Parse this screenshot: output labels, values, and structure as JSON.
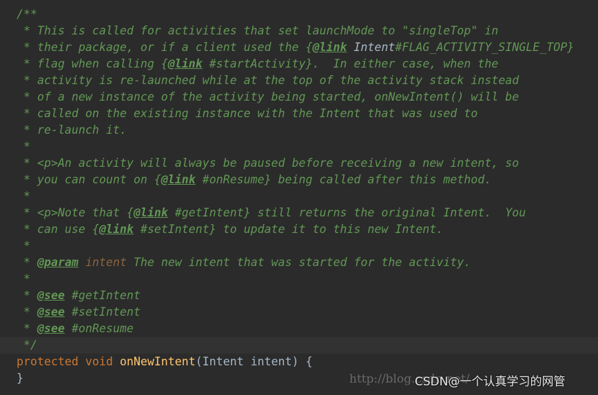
{
  "colors": {
    "background": "#2b2b2b",
    "comment": "#629755",
    "keyword": "#cc7832",
    "function": "#ffc66d",
    "identifier": "#a9b7c6",
    "param": "#8a653b",
    "current_line": "#323232"
  },
  "current_line_index": 20,
  "lines": [
    [
      [
        "c",
        "/**"
      ]
    ],
    [
      [
        "c",
        " * This is called for activities that set launchMode to \"singleTop\" in"
      ]
    ],
    [
      [
        "c",
        " * their package, or if a client used the {"
      ],
      [
        "t",
        "@link"
      ],
      [
        "c",
        " "
      ],
      [
        "r",
        "Intent"
      ],
      [
        "c",
        "#FLAG_ACTIVITY_SINGLE_TOP}"
      ]
    ],
    [
      [
        "c",
        " * flag when calling {"
      ],
      [
        "t",
        "@link"
      ],
      [
        "c",
        " #startActivity}.  In either case, when the"
      ]
    ],
    [
      [
        "c",
        " * activity is re-launched while at the top of the activity stack instead"
      ]
    ],
    [
      [
        "c",
        " * of a new instance of the activity being started, onNewIntent() will be"
      ]
    ],
    [
      [
        "c",
        " * called on the existing instance with the Intent that was used to"
      ]
    ],
    [
      [
        "c",
        " * re-launch it."
      ]
    ],
    [
      [
        "c",
        " *"
      ]
    ],
    [
      [
        "c",
        " * <p>An activity will always be paused before receiving a new intent, so"
      ]
    ],
    [
      [
        "c",
        " * you can count on {"
      ],
      [
        "t",
        "@link"
      ],
      [
        "c",
        " #onResume} being called after this method."
      ]
    ],
    [
      [
        "c",
        " *"
      ]
    ],
    [
      [
        "c",
        " * <p>Note that {"
      ],
      [
        "t",
        "@link"
      ],
      [
        "c",
        " #getIntent} still returns the original Intent.  You"
      ]
    ],
    [
      [
        "c",
        " * can use {"
      ],
      [
        "t",
        "@link"
      ],
      [
        "c",
        " #setIntent} to update it to this new Intent."
      ]
    ],
    [
      [
        "c",
        " *"
      ]
    ],
    [
      [
        "c",
        " * "
      ],
      [
        "t",
        "@param"
      ],
      [
        "c",
        " "
      ],
      [
        "p",
        "intent"
      ],
      [
        "c",
        " The new intent that was started for the activity."
      ]
    ],
    [
      [
        "c",
        " *"
      ]
    ],
    [
      [
        "c",
        " * "
      ],
      [
        "t",
        "@see"
      ],
      [
        "c",
        " #getIntent"
      ]
    ],
    [
      [
        "c",
        " * "
      ],
      [
        "t",
        "@see"
      ],
      [
        "c",
        " #setIntent"
      ]
    ],
    [
      [
        "c",
        " * "
      ],
      [
        "t",
        "@see"
      ],
      [
        "c",
        " #onResume"
      ]
    ],
    [
      [
        "c",
        " */"
      ]
    ],
    [
      [
        "kw",
        "protected void "
      ],
      [
        "fn",
        "onNewIntent"
      ],
      [
        "id",
        "(Intent intent) {"
      ]
    ],
    [
      [
        "id",
        "}"
      ]
    ]
  ],
  "watermark": {
    "url": "http://blog.csdn.net/",
    "brand": "CSDN@一个认真学习的网管"
  }
}
